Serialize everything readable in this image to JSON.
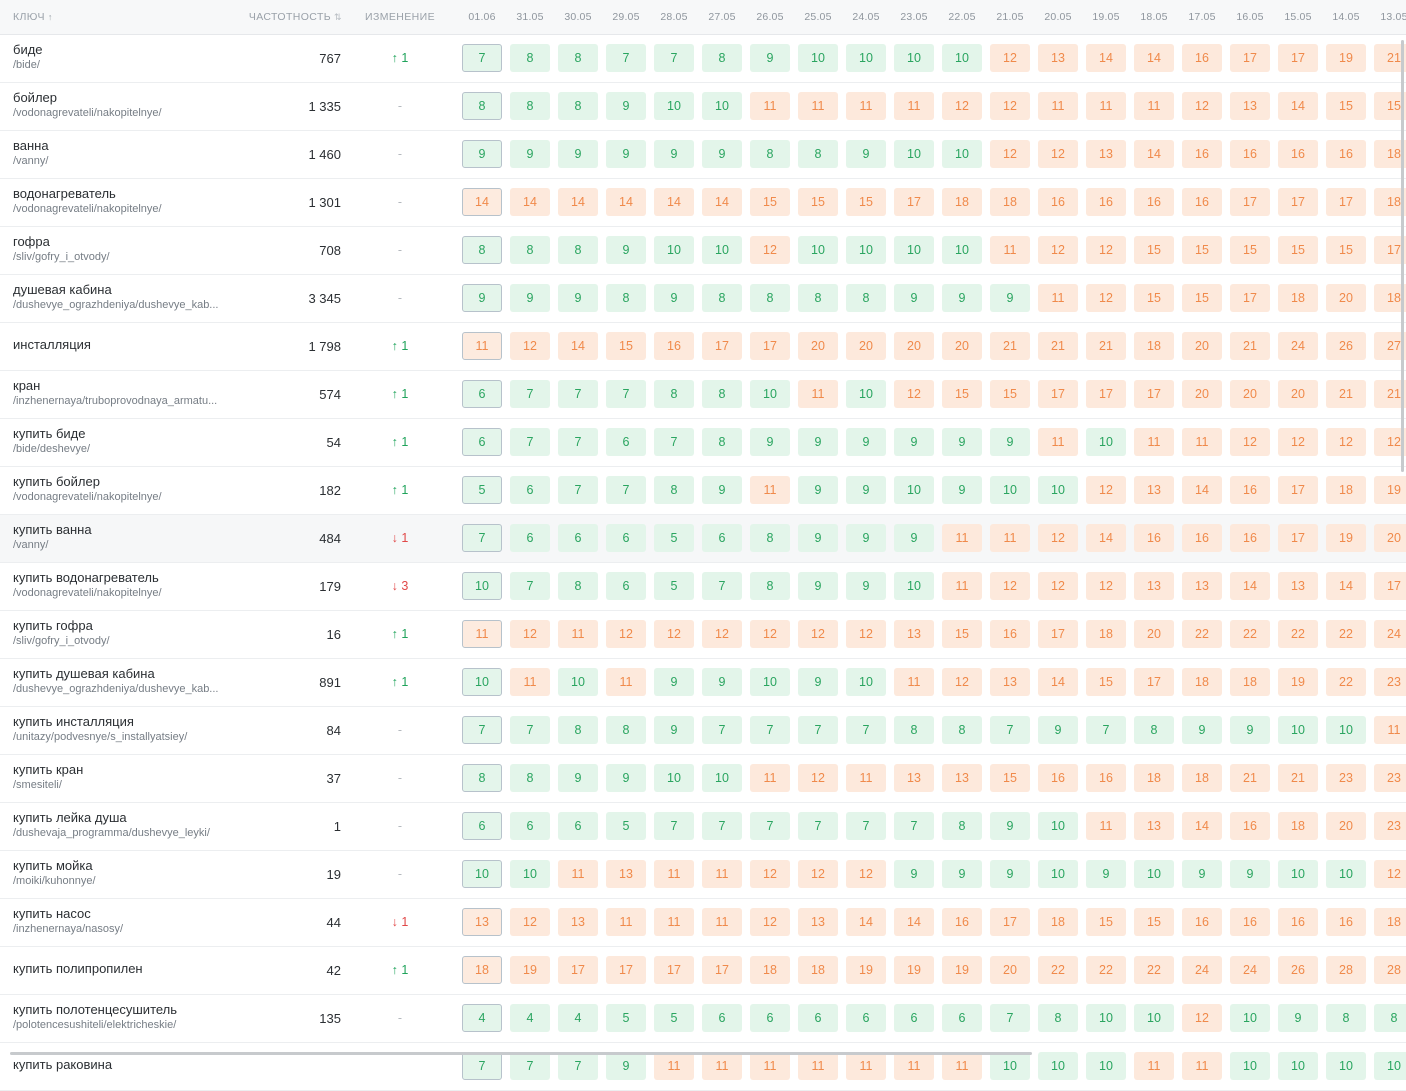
{
  "table": {
    "headers": {
      "key": "КЛЮЧ",
      "key_sort": "↑",
      "frequency": "ЧАСТОТНОСТЬ",
      "frequency_sort": "⇅",
      "change": "ИЗМЕНЕНИЕ"
    },
    "dates": [
      "01.06",
      "31.05",
      "30.05",
      "29.05",
      "28.05",
      "27.05",
      "26.05",
      "25.05",
      "24.05",
      "23.05",
      "22.05",
      "21.05",
      "20.05",
      "19.05",
      "18.05",
      "17.05",
      "16.05",
      "15.05",
      "14.05",
      "13.05"
    ],
    "rows": [
      {
        "keyword": "биде",
        "url": "/bide/",
        "frequency": "767",
        "change": "↑ 1",
        "change_dir": "up",
        "positions": [
          "7",
          "8",
          "8",
          "7",
          "7",
          "8",
          "9",
          "10",
          "10",
          "10",
          "10",
          "12",
          "13",
          "14",
          "14",
          "16",
          "17",
          "17",
          "19",
          "21"
        ]
      },
      {
        "keyword": "бойлер",
        "url": "/vodonagrevateli/nakopitelnye/",
        "frequency": "1 335",
        "change": "-",
        "change_dir": "none",
        "positions": [
          "8",
          "8",
          "8",
          "9",
          "10",
          "10",
          "11",
          "11",
          "11",
          "11",
          "12",
          "12",
          "11",
          "11",
          "11",
          "12",
          "13",
          "14",
          "15",
          "15"
        ]
      },
      {
        "keyword": "ванна",
        "url": "/vanny/",
        "frequency": "1 460",
        "change": "-",
        "change_dir": "none",
        "positions": [
          "9",
          "9",
          "9",
          "9",
          "9",
          "9",
          "8",
          "8",
          "9",
          "10",
          "10",
          "12",
          "12",
          "13",
          "14",
          "16",
          "16",
          "16",
          "16",
          "18"
        ]
      },
      {
        "keyword": "водонагреватель",
        "url": "/vodonagrevateli/nakopitelnye/",
        "frequency": "1 301",
        "change": "-",
        "change_dir": "none",
        "positions": [
          "14",
          "14",
          "14",
          "14",
          "14",
          "14",
          "15",
          "15",
          "15",
          "17",
          "18",
          "18",
          "16",
          "16",
          "16",
          "16",
          "17",
          "17",
          "17",
          "18"
        ]
      },
      {
        "keyword": "гофра",
        "url": "/sliv/gofry_i_otvody/",
        "frequency": "708",
        "change": "-",
        "change_dir": "none",
        "positions": [
          "8",
          "8",
          "8",
          "9",
          "10",
          "10",
          "12",
          "10",
          "10",
          "10",
          "10",
          "11",
          "12",
          "12",
          "15",
          "15",
          "15",
          "15",
          "15",
          "17"
        ]
      },
      {
        "keyword": "душевая кабина",
        "url": "/dushevye_ograzhdeniya/dushevye_kab...",
        "frequency": "3 345",
        "change": "-",
        "change_dir": "none",
        "positions": [
          "9",
          "9",
          "9",
          "8",
          "9",
          "8",
          "8",
          "8",
          "8",
          "9",
          "9",
          "9",
          "11",
          "12",
          "15",
          "15",
          "17",
          "18",
          "20",
          "18"
        ]
      },
      {
        "keyword": "инсталляция",
        "url": "",
        "frequency": "1 798",
        "change": "↑ 1",
        "change_dir": "up",
        "positions": [
          "11",
          "12",
          "14",
          "15",
          "16",
          "17",
          "17",
          "20",
          "20",
          "20",
          "20",
          "21",
          "21",
          "21",
          "18",
          "20",
          "21",
          "24",
          "26",
          "27"
        ]
      },
      {
        "keyword": "кран",
        "url": "/inzhenernaya/truboprovodnaya_armatu...",
        "frequency": "574",
        "change": "↑ 1",
        "change_dir": "up",
        "positions": [
          "6",
          "7",
          "7",
          "7",
          "8",
          "8",
          "10",
          "11",
          "10",
          "12",
          "15",
          "15",
          "17",
          "17",
          "17",
          "20",
          "20",
          "20",
          "21",
          "21"
        ]
      },
      {
        "keyword": "купить биде",
        "url": "/bide/deshevye/",
        "frequency": "54",
        "change": "↑ 1",
        "change_dir": "up",
        "positions": [
          "6",
          "7",
          "7",
          "6",
          "7",
          "8",
          "9",
          "9",
          "9",
          "9",
          "9",
          "9",
          "11",
          "10",
          "11",
          "11",
          "12",
          "12",
          "12",
          "12"
        ]
      },
      {
        "keyword": "купить бойлер",
        "url": "/vodonagrevateli/nakopitelnye/",
        "frequency": "182",
        "change": "↑ 1",
        "change_dir": "up",
        "positions": [
          "5",
          "6",
          "7",
          "7",
          "8",
          "9",
          "11",
          "9",
          "9",
          "10",
          "9",
          "10",
          "10",
          "12",
          "13",
          "14",
          "16",
          "17",
          "18",
          "19"
        ]
      },
      {
        "keyword": "купить ванна",
        "url": "/vanny/",
        "frequency": "484",
        "change": "↓ 1",
        "change_dir": "down",
        "highlight": true,
        "positions": [
          "7",
          "6",
          "6",
          "6",
          "5",
          "6",
          "8",
          "9",
          "9",
          "9",
          "11",
          "11",
          "12",
          "14",
          "16",
          "16",
          "16",
          "17",
          "19",
          "20"
        ]
      },
      {
        "keyword": "купить водонагреватель",
        "url": "/vodonagrevateli/nakopitelnye/",
        "frequency": "179",
        "change": "↓ 3",
        "change_dir": "down",
        "positions": [
          "10",
          "7",
          "8",
          "6",
          "5",
          "7",
          "8",
          "9",
          "9",
          "10",
          "11",
          "12",
          "12",
          "12",
          "13",
          "13",
          "14",
          "13",
          "14",
          "17"
        ]
      },
      {
        "keyword": "купить гофра",
        "url": "/sliv/gofry_i_otvody/",
        "frequency": "16",
        "change": "↑ 1",
        "change_dir": "up",
        "positions": [
          "11",
          "12",
          "11",
          "12",
          "12",
          "12",
          "12",
          "12",
          "12",
          "13",
          "15",
          "16",
          "17",
          "18",
          "20",
          "22",
          "22",
          "22",
          "22",
          "24"
        ]
      },
      {
        "keyword": "купить душевая кабина",
        "url": "/dushevye_ograzhdeniya/dushevye_kab...",
        "frequency": "891",
        "change": "↑ 1",
        "change_dir": "up",
        "positions": [
          "10",
          "11",
          "10",
          "11",
          "9",
          "9",
          "10",
          "9",
          "10",
          "11",
          "12",
          "13",
          "14",
          "15",
          "17",
          "18",
          "18",
          "19",
          "22",
          "23"
        ]
      },
      {
        "keyword": "купить инсталляция",
        "url": "/unitazy/podvesnye/s_installyatsiey/",
        "frequency": "84",
        "change": "-",
        "change_dir": "none",
        "positions": [
          "7",
          "7",
          "8",
          "8",
          "9",
          "7",
          "7",
          "7",
          "7",
          "8",
          "8",
          "7",
          "9",
          "7",
          "8",
          "9",
          "9",
          "10",
          "10",
          "11"
        ]
      },
      {
        "keyword": "купить кран",
        "url": "/smesiteli/",
        "frequency": "37",
        "change": "-",
        "change_dir": "none",
        "positions": [
          "8",
          "8",
          "9",
          "9",
          "10",
          "10",
          "11",
          "12",
          "11",
          "13",
          "13",
          "15",
          "16",
          "16",
          "18",
          "18",
          "21",
          "21",
          "23",
          "23"
        ]
      },
      {
        "keyword": "купить лейка душа",
        "url": "/dushevaja_programma/dushevye_leyki/",
        "frequency": "1",
        "change": "-",
        "change_dir": "none",
        "positions": [
          "6",
          "6",
          "6",
          "5",
          "7",
          "7",
          "7",
          "7",
          "7",
          "7",
          "8",
          "9",
          "10",
          "11",
          "13",
          "14",
          "16",
          "18",
          "20",
          "23"
        ]
      },
      {
        "keyword": "купить мойка",
        "url": "/moiki/kuhonnye/",
        "frequency": "19",
        "change": "-",
        "change_dir": "none",
        "positions": [
          "10",
          "10",
          "11",
          "13",
          "11",
          "11",
          "12",
          "12",
          "12",
          "9",
          "9",
          "9",
          "10",
          "9",
          "10",
          "9",
          "9",
          "10",
          "10",
          "12"
        ]
      },
      {
        "keyword": "купить насос",
        "url": "/inzhenernaya/nasosy/",
        "frequency": "44",
        "change": "↓ 1",
        "change_dir": "down",
        "positions": [
          "13",
          "12",
          "13",
          "11",
          "11",
          "11",
          "12",
          "13",
          "14",
          "14",
          "16",
          "17",
          "18",
          "15",
          "15",
          "16",
          "16",
          "16",
          "16",
          "18"
        ]
      },
      {
        "keyword": "купить полипропилен",
        "url": "",
        "frequency": "42",
        "change": "↑ 1",
        "change_dir": "up",
        "positions": [
          "18",
          "19",
          "17",
          "17",
          "17",
          "17",
          "18",
          "18",
          "19",
          "19",
          "19",
          "20",
          "22",
          "22",
          "22",
          "24",
          "24",
          "26",
          "28",
          "28"
        ]
      },
      {
        "keyword": "купить полотенцесушитель",
        "url": "/polotencesushiteli/elektricheskie/",
        "frequency": "135",
        "change": "-",
        "change_dir": "none",
        "positions": [
          "4",
          "4",
          "4",
          "5",
          "5",
          "6",
          "6",
          "6",
          "6",
          "6",
          "6",
          "7",
          "8",
          "10",
          "10",
          "12",
          "10",
          "9",
          "8",
          "8"
        ]
      },
      {
        "keyword": "купить раковина",
        "url": "",
        "frequency": "",
        "change": "",
        "change_dir": "none",
        "positions": [
          "7",
          "7",
          "7",
          "9",
          "11",
          "11",
          "11",
          "11",
          "11",
          "11",
          "11",
          "10",
          "10",
          "10",
          "11",
          "11",
          "10",
          "10",
          "10",
          "10"
        ]
      }
    ]
  },
  "colors": {
    "good": "#2aa560",
    "good_bg": "#e3f5ea",
    "bad": "#f08a4b",
    "bad_bg": "#fde9dc",
    "up": "#1fa35b",
    "down": "#e14848"
  },
  "threshold_good_max": 10
}
